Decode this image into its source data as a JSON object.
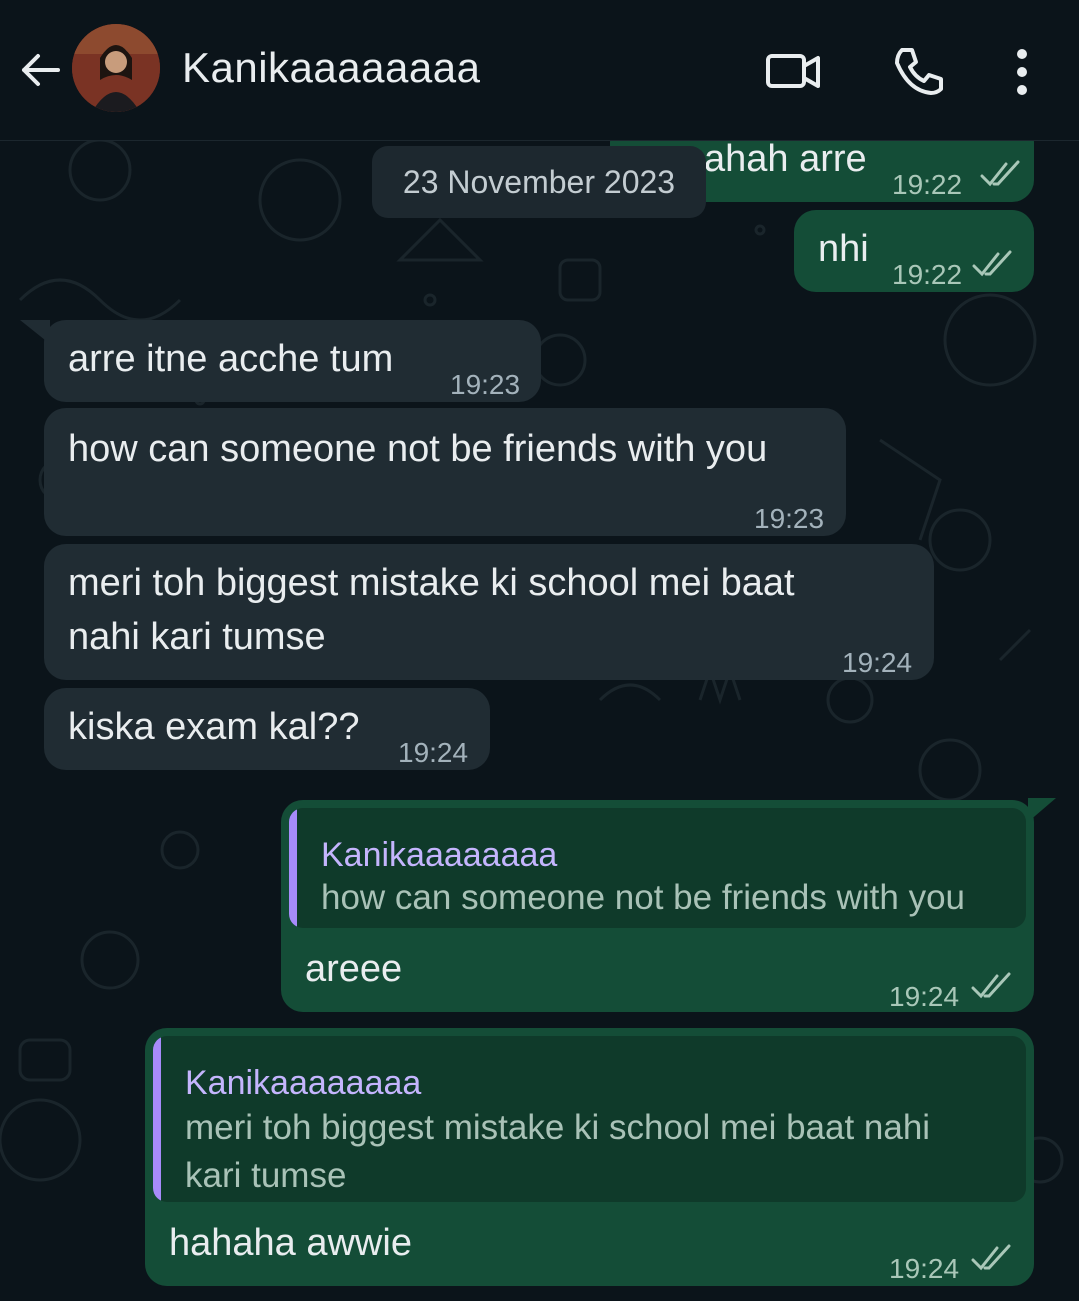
{
  "header": {
    "contact_name": "Kanikaaaaaaaa"
  },
  "date_divider": "23 November 2023",
  "messages": [
    {
      "dir": "out",
      "text": "ahah arre",
      "time": "19:22"
    },
    {
      "dir": "out",
      "text": "nhi",
      "time": "19:22"
    },
    {
      "dir": "in",
      "text": "arre itne acche tum",
      "time": "19:23"
    },
    {
      "dir": "in",
      "text": "how can someone not be friends with you",
      "time": "19:23"
    },
    {
      "dir": "in",
      "text_line1": "meri toh biggest mistake ki school mei baat",
      "text_line2": "nahi kari tumse",
      "time": "19:24"
    },
    {
      "dir": "in",
      "text": "kiska exam kal??",
      "time": "19:24"
    },
    {
      "dir": "out",
      "quote_name": "Kanikaaaaaaaa",
      "quote_text": "how can someone not be friends with you",
      "text": "areee",
      "time": "19:24"
    },
    {
      "dir": "out",
      "quote_name": "Kanikaaaaaaaa",
      "quote_line1": "meri toh biggest mistake ki school mei baat nahi",
      "quote_line2": "kari tumse",
      "text": "hahaha awwie",
      "time": "19:24"
    }
  ],
  "colors": {
    "background": "#0b141a",
    "incoming_bubble": "#202c33",
    "outgoing_bubble": "#144d37",
    "read_ticks": "#a9c7b8",
    "quote_accent": "#a78bfa"
  }
}
